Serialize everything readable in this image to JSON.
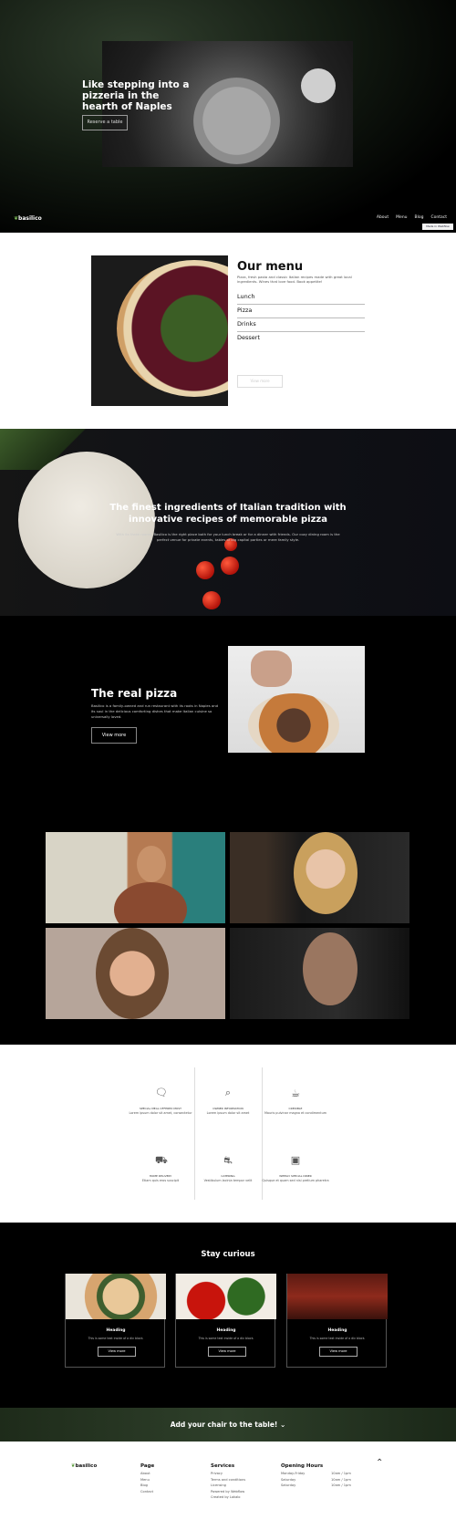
{
  "hero": {
    "title": "Like stepping into a pizzeria in the hearth of Naples",
    "button": "Reserve a table"
  },
  "header": {
    "logo": "basilico",
    "nav": [
      "About",
      "Menu",
      "Blog",
      "Contact"
    ],
    "badge": "Made in Webflow"
  },
  "menu": {
    "title": "Our menu",
    "description": "Pizza, fresh pasta and classic Italian recipes made with great local ingredients. Wines that love food. Book appetite!",
    "items": [
      "Lunch",
      "Pizza",
      "Drinks",
      "Dessert"
    ],
    "button": "View more"
  },
  "ingredients": {
    "title": "The finest ingredients of Italian tradition with innovative recipes of memorable pizza",
    "text": "With its three rooms, Basilico is the right place both for your lunch break or for a dinner with friends. Our cozy dining room is the perfect venue for private events, tables of big capital parties or mere family style."
  },
  "real_pizza": {
    "title": "The real pizza",
    "text": "Basilico is a family-owned and run restaurant with its roots in Naples and its soul in the delicious comforting dishes that make Italian cuisine so universally loved.",
    "button": "View more"
  },
  "features": [
    {
      "icon": "chat-icon",
      "title": "SPECIAL MEAL OFFERED MOST",
      "text": "Lorem ipsum dolor sit amet, consectetur"
    },
    {
      "icon": "search-icon",
      "title": "OWNER INFORMATION",
      "text": "Lorem ipsum dolor sit amet"
    },
    {
      "icon": "coffee-icon",
      "title": "CREDIBLE",
      "text": "Mauris pulvinar magna et condimentum"
    },
    {
      "icon": "truck-icon",
      "title": "HOME DELIVERY",
      "text": "Etiam quis eros suscipit"
    },
    {
      "icon": "scooter-icon",
      "title": "CATERING",
      "text": "Vestibulum lacinia tempor velit"
    },
    {
      "icon": "camera-icon",
      "title": "WEEKLY SPECIAL DINER",
      "text": "Quisque et quam sed nisi pretium pharetra"
    }
  ],
  "curious": {
    "title": "Stay curious",
    "cards": [
      {
        "heading": "Heading",
        "text": "This is some text inside of a div block.",
        "button": "View more"
      },
      {
        "heading": "Heading",
        "text": "This is some text inside of a div block.",
        "button": "View more"
      },
      {
        "heading": "Heading",
        "text": "This is some text inside of a div block.",
        "button": "View more"
      }
    ]
  },
  "chair": {
    "text": "Add your chair to the table!"
  },
  "footer": {
    "logo": "basilico",
    "page": {
      "title": "Page",
      "links": [
        "About",
        "Menu",
        "Blog",
        "Contact"
      ]
    },
    "services": {
      "title": "Services",
      "links": [
        "Privacy",
        "Terms and conditions",
        "Licensing",
        "Powered by Webflow",
        "Created by Lokalo"
      ]
    },
    "hours": {
      "title": "Opening Hours",
      "days": [
        "Monday-Friday",
        "Saturday",
        "Saturday"
      ],
      "times": [
        "10am / 1pm",
        "10am / 1pm",
        "10am / 1pm"
      ]
    }
  }
}
